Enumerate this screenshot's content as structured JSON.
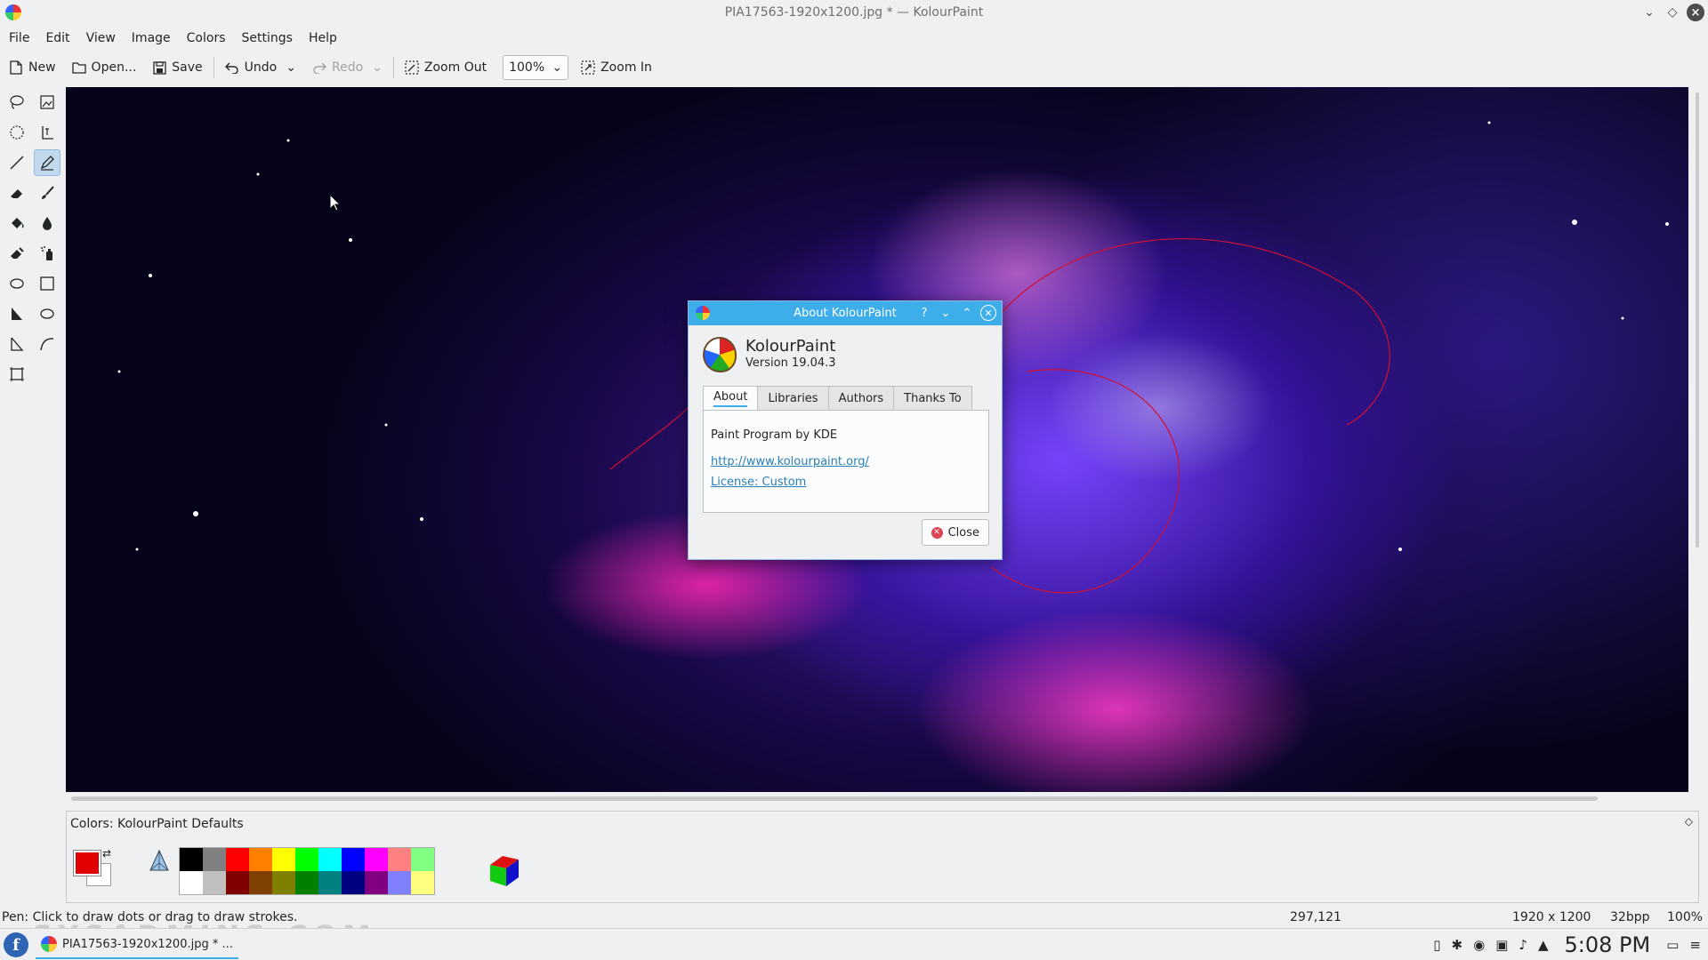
{
  "window": {
    "title": "PIA17563-1920x1200.jpg * — KolourPaint"
  },
  "menu": [
    "File",
    "Edit",
    "View",
    "Image",
    "Colors",
    "Settings",
    "Help"
  ],
  "toolbar": {
    "new_label": "New",
    "open_label": "Open...",
    "save_label": "Save",
    "undo_label": "Undo",
    "redo_label": "Redo",
    "zoom_out_label": "Zoom Out",
    "zoom_value": "100%",
    "zoom_in_label": "Zoom In"
  },
  "tools": [
    {
      "name": "free-form-selection",
      "icon": "lasso-icon"
    },
    {
      "name": "selection-image",
      "icon": "select-image-icon"
    },
    {
      "name": "elliptical-selection",
      "icon": "ellipse-select-icon"
    },
    {
      "name": "text",
      "icon": "text-cursor-icon"
    },
    {
      "name": "line",
      "icon": "line-icon"
    },
    {
      "name": "pen",
      "icon": "pen-icon",
      "active": true
    },
    {
      "name": "eraser",
      "icon": "eraser-icon"
    },
    {
      "name": "brush",
      "icon": "brush-icon"
    },
    {
      "name": "flood-fill",
      "icon": "bucket-icon"
    },
    {
      "name": "color-picker",
      "icon": "dropper-icon"
    },
    {
      "name": "color-eraser",
      "icon": "color-eraser-icon"
    },
    {
      "name": "spraycan",
      "icon": "spraycan-icon"
    },
    {
      "name": "ellipse",
      "icon": "ellipse-icon"
    },
    {
      "name": "rectangle",
      "icon": "rectangle-icon"
    },
    {
      "name": "polygon",
      "icon": "polygon-icon"
    },
    {
      "name": "rounded-ellipse",
      "icon": "ellipse-outline-icon"
    },
    {
      "name": "polyline",
      "icon": "polyline-icon"
    },
    {
      "name": "curve",
      "icon": "curve-icon"
    },
    {
      "name": "zoom",
      "icon": "zoom-rect-icon"
    }
  ],
  "colors_panel": {
    "title": "Colors: KolourPaint Defaults",
    "foreground": "#e00000",
    "background": "#ffffff",
    "palette_top": [
      "#000000",
      "#808080",
      "#ff0000",
      "#ff8000",
      "#ffff00",
      "#00ff00",
      "#00ffff",
      "#0000ff",
      "#ff00ff",
      "#ff8080",
      "#80ff80"
    ],
    "palette_bottom": [
      "#ffffff",
      "#c0c0c0",
      "#800000",
      "#804000",
      "#808000",
      "#008000",
      "#008080",
      "#000080",
      "#800080",
      "#8080ff",
      "#ffff80"
    ]
  },
  "status": {
    "message": "Pen: Click to draw dots or drag to draw strokes.",
    "coords": "297,121",
    "size": "1920 x 1200",
    "depth": "32bpp",
    "zoom": "100%"
  },
  "taskbar": {
    "launcher": "f",
    "task_label": "PIA17563-1920x1200.jpg * ...",
    "clock": "5:08 PM"
  },
  "watermark": "SYSADMINS.COM",
  "dialog": {
    "title": "About KolourPaint",
    "app_name": "KolourPaint",
    "version": "Version 19.04.3",
    "tabs": [
      "About",
      "Libraries",
      "Authors",
      "Thanks To"
    ],
    "active_tab": "About",
    "description": "Paint Program by KDE",
    "homepage": "http://www.kolourpaint.org/",
    "license": "License: Custom",
    "close_label": "Close"
  }
}
